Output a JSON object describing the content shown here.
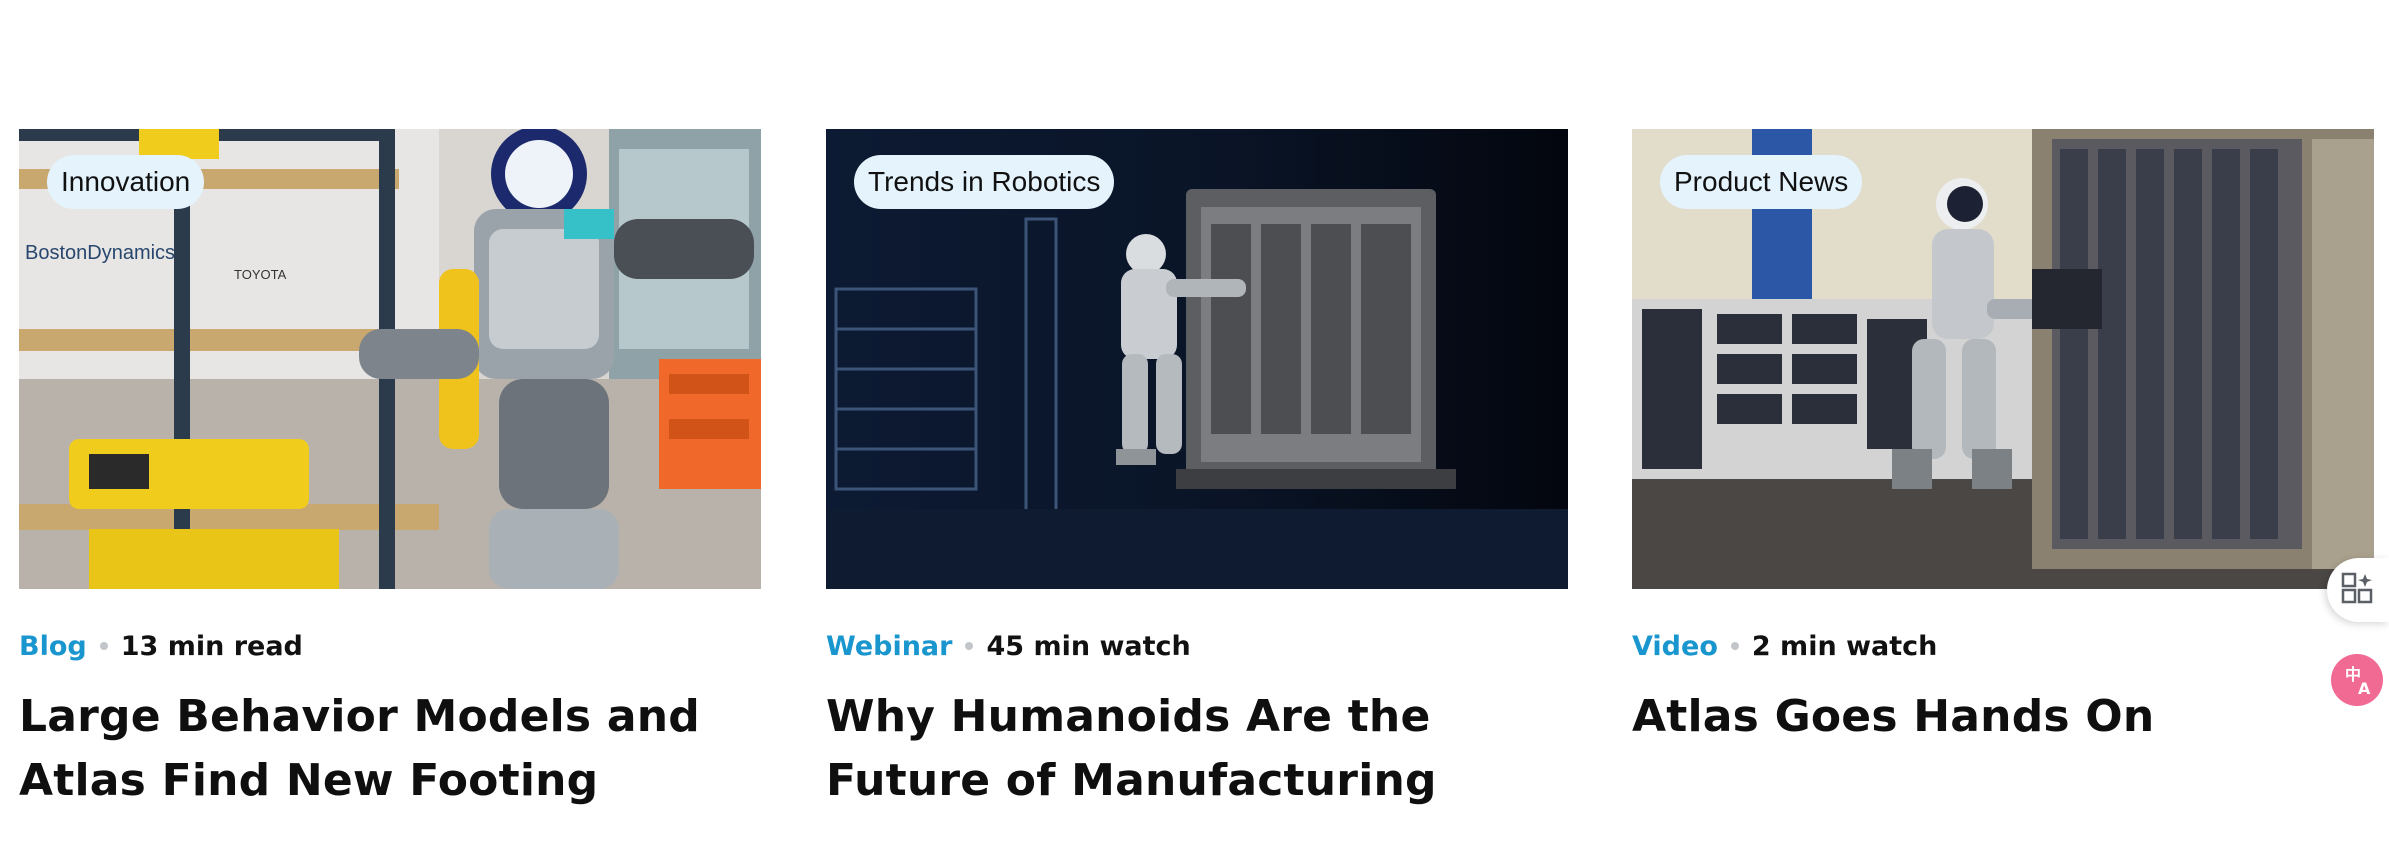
{
  "cards": [
    {
      "tag": "Innovation",
      "type": "Blog",
      "duration": "13 min read",
      "title": "Large Behavior Models and Atlas Find New Footing",
      "image_alt": "Atlas humanoid robot picking parts beside yellow Spot robots on shelves"
    },
    {
      "tag": "Trends in Robotics",
      "type": "Webinar",
      "duration": "45 min watch",
      "title": "Why Humanoids Are the Future of Manufacturing",
      "image_alt": "Atlas humanoid robot working at a parts cart in a dark factory"
    },
    {
      "tag": "Product News",
      "type": "Video",
      "duration": "2 min watch",
      "title": "Atlas Goes Hands On",
      "image_alt": "Atlas humanoid robot loading engine cover into a numbered rack"
    }
  ],
  "colors": {
    "accent": "#1a96cf",
    "pill_bg": "#e4f3fc",
    "title": "#0f0f0f"
  },
  "floating_buttons": [
    {
      "icon": "apps-grid-icon"
    },
    {
      "icon": "translate-icon"
    }
  ]
}
